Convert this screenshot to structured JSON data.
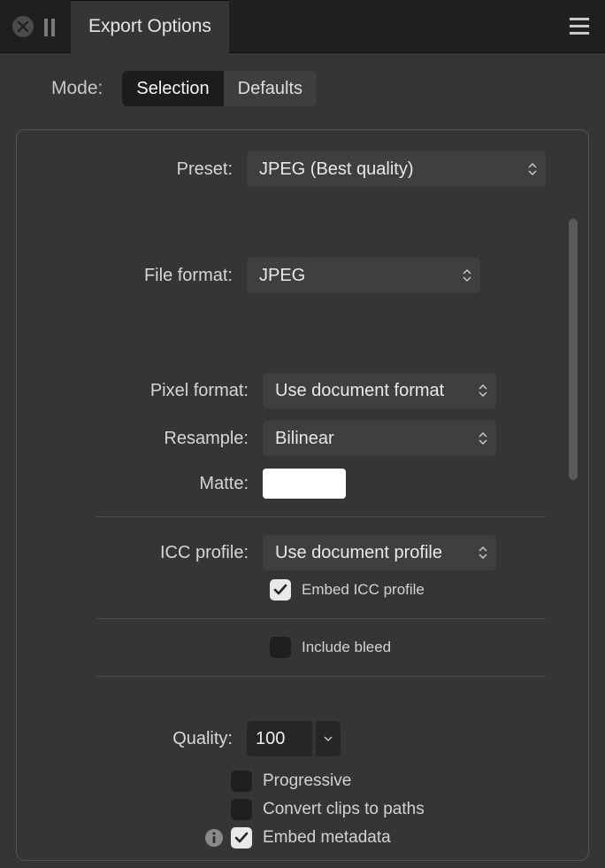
{
  "title": "Export Options",
  "mode": {
    "label": "Mode:",
    "options": [
      "Selection",
      "Defaults"
    ],
    "active": 0
  },
  "preset": {
    "label": "Preset:",
    "value": "JPEG (Best quality)"
  },
  "file_format": {
    "label": "File format:",
    "value": "JPEG"
  },
  "pixel_format": {
    "label": "Pixel format:",
    "value": "Use document format"
  },
  "resample": {
    "label": "Resample:",
    "value": "Bilinear"
  },
  "matte": {
    "label": "Matte:",
    "color": "#FFFFFF"
  },
  "icc_profile": {
    "label": "ICC profile:",
    "value": "Use document profile"
  },
  "embed_icc": {
    "label": "Embed ICC profile",
    "checked": true
  },
  "include_bleed": {
    "label": "Include bleed",
    "checked": false
  },
  "quality": {
    "label": "Quality:",
    "value": "100"
  },
  "progressive": {
    "label": "Progressive",
    "checked": false
  },
  "convert_clips": {
    "label": "Convert clips to paths",
    "checked": false
  },
  "embed_metadata": {
    "label": "Embed metadata",
    "checked": true
  }
}
